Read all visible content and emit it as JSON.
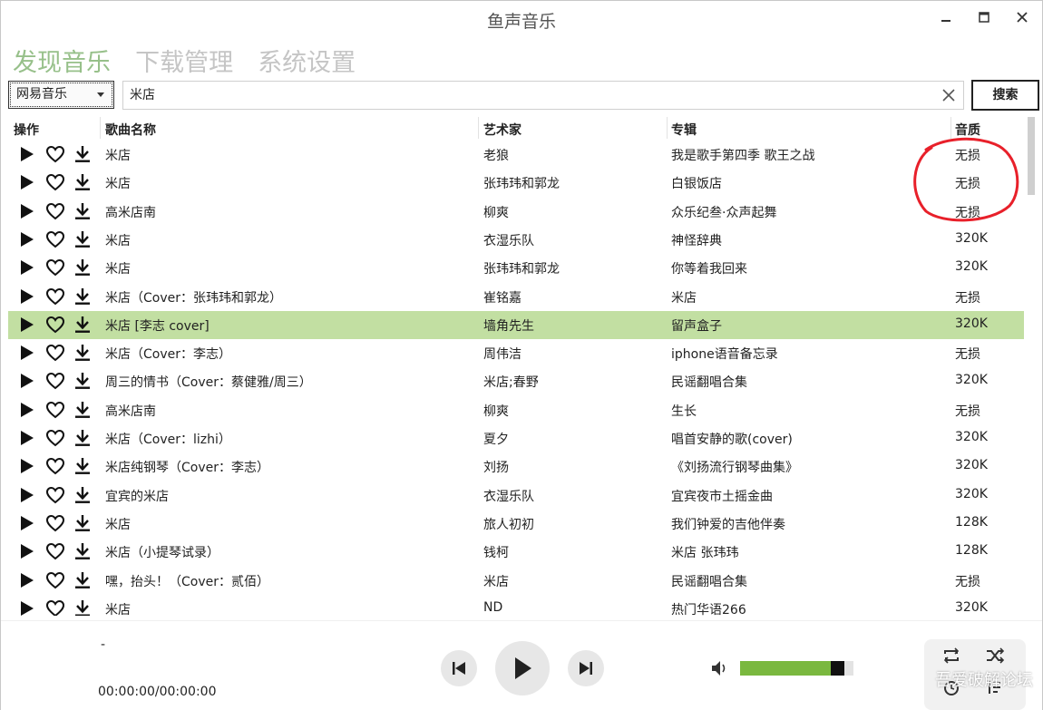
{
  "window": {
    "title": "鱼声音乐"
  },
  "nav": [
    {
      "label": "发现音乐",
      "active": true
    },
    {
      "label": "下载管理",
      "active": false
    },
    {
      "label": "系统设置",
      "active": false
    }
  ],
  "source_select": {
    "value": "网易音乐"
  },
  "search": {
    "value": "米店",
    "button": "搜索"
  },
  "columns": {
    "ops": "操作",
    "name": "歌曲名称",
    "artist": "艺术家",
    "album": "专辑",
    "quality": "音质"
  },
  "selected_index": 6,
  "songs": [
    {
      "name": "米店",
      "artist": "老狼",
      "album": "我是歌手第四季 歌王之战",
      "quality": "无损"
    },
    {
      "name": "米店",
      "artist": "张玮玮和郭龙",
      "album": "白银饭店",
      "quality": "无损"
    },
    {
      "name": "高米店南",
      "artist": "柳爽",
      "album": "众乐纪叁·众声起舞",
      "quality": "无损"
    },
    {
      "name": "米店",
      "artist": "衣湿乐队",
      "album": "神怪辞典",
      "quality": "320K"
    },
    {
      "name": "米店",
      "artist": "张玮玮和郭龙",
      "album": "你等着我回来",
      "quality": "320K"
    },
    {
      "name": "米店（Cover：张玮玮和郭龙）",
      "artist": "崔铭嘉",
      "album": "米店",
      "quality": "无损"
    },
    {
      "name": "米店 [李志 cover]",
      "artist": "墙角先生",
      "album": "留声盒子",
      "quality": "320K"
    },
    {
      "name": "米店（Cover：李志）",
      "artist": "周伟洁",
      "album": "iphone语音备忘录",
      "quality": "无损"
    },
    {
      "name": "周三的情书（Cover：蔡健雅/周三）",
      "artist": "米店;春野",
      "album": "民谣翻唱合集",
      "quality": "320K"
    },
    {
      "name": "高米店南",
      "artist": "柳爽",
      "album": "生长",
      "quality": "无损"
    },
    {
      "name": "米店（Cover：lizhi）",
      "artist": "夏夕",
      "album": "唱首安静的歌(cover)",
      "quality": "320K"
    },
    {
      "name": "米店纯钢琴（Cover：李志）",
      "artist": "刘扬",
      "album": "《刘扬流行钢琴曲集》",
      "quality": "320K"
    },
    {
      "name": "宜宾的米店",
      "artist": "衣湿乐队",
      "album": "宜宾夜市土摇金曲",
      "quality": "320K"
    },
    {
      "name": "米店",
      "artist": "旅人初初",
      "album": "我们钟爱的吉他伴奏",
      "quality": "128K"
    },
    {
      "name": "米店（小提琴试录）",
      "artist": "钱柯",
      "album": "米店 张玮玮",
      "quality": "128K"
    },
    {
      "name": "嘿，抬头！（Cover：贰佰）",
      "artist": "米店",
      "album": "民谣翻唱合集",
      "quality": "无损"
    },
    {
      "name": "米店",
      "artist": "ND",
      "album": "热门华语266",
      "quality": "320K"
    }
  ],
  "player": {
    "now_playing": "-",
    "time": "00:00:00/00:00:00",
    "volume_percent": 80
  },
  "watermark": "吾爱破解论坛",
  "colors": {
    "accent": "#97c08a",
    "selected_row": "#c2dfa2",
    "volume": "#7ab83f",
    "annotation": "#e8202a"
  }
}
